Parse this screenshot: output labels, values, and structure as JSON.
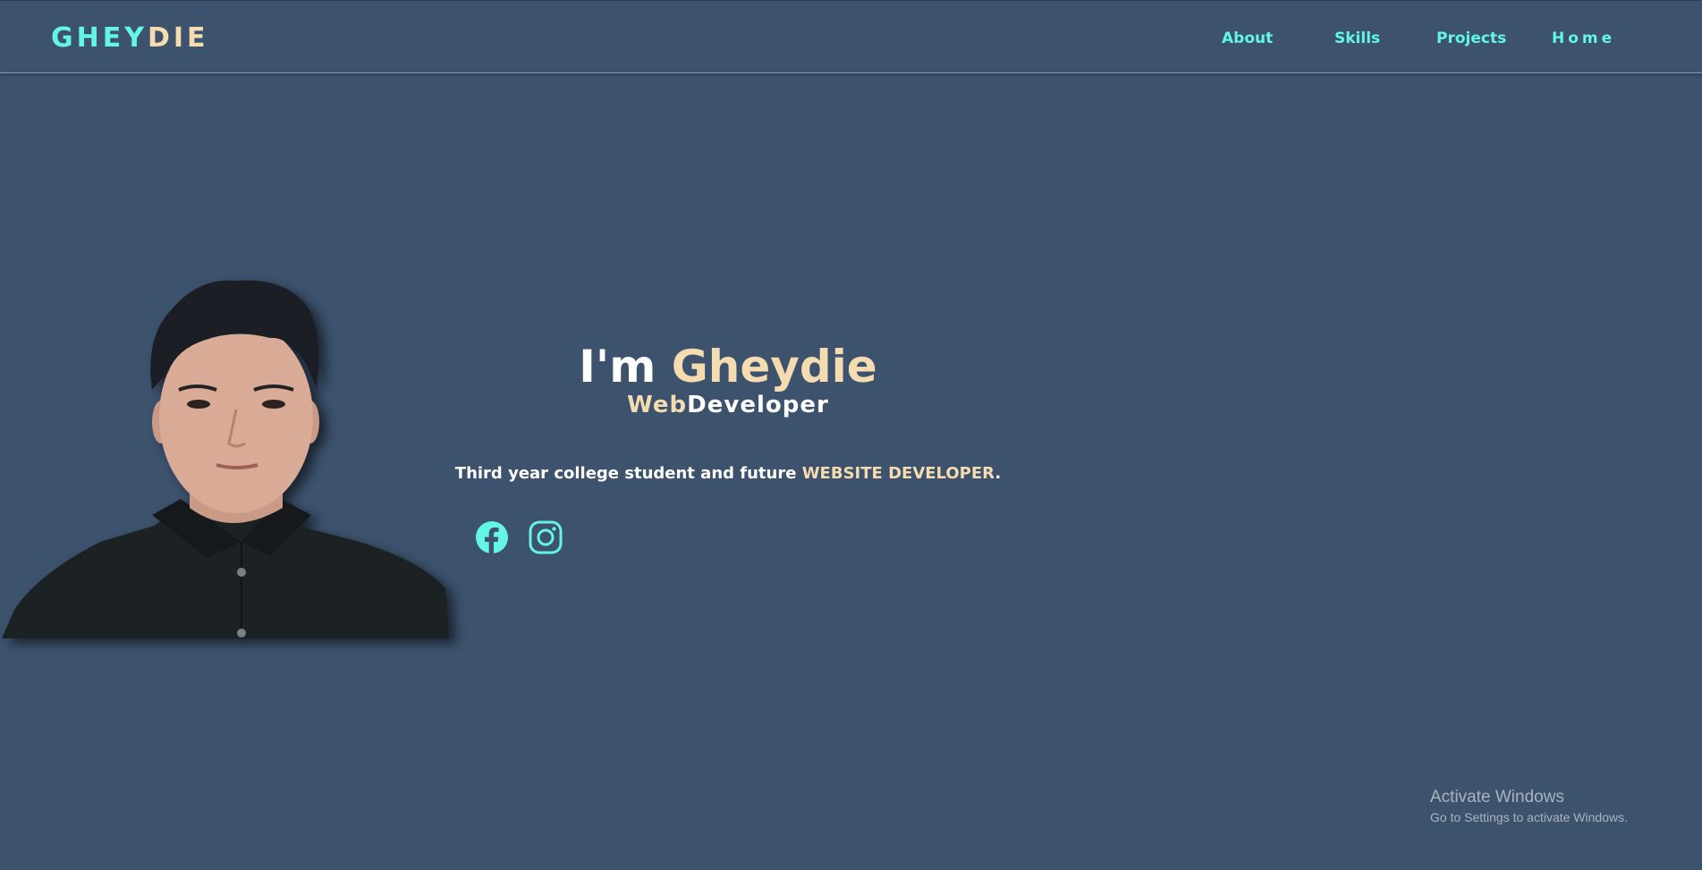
{
  "header": {
    "logo_part1": "GHEY",
    "logo_part2": "DIE",
    "nav": [
      {
        "label": "About"
      },
      {
        "label": "Skills"
      },
      {
        "label": "Projects"
      },
      {
        "label": "Home"
      }
    ]
  },
  "hero": {
    "greeting": "I'm ",
    "name": "Gheydie",
    "role_accent": "Web",
    "role": "Developer",
    "desc_prefix": "Third year college student and future ",
    "desc_accent": "WEBSITE DEVELOPER",
    "desc_suffix": "."
  },
  "social": [
    {
      "icon": "facebook-icon"
    },
    {
      "icon": "instagram-icon"
    }
  ],
  "watermark": {
    "line1": "Activate Windows",
    "line2": "Go to Settings to activate Windows."
  },
  "colors": {
    "background": "#3c526d",
    "accent_cyan": "#64f5e6",
    "accent_cream": "#f4dcb0",
    "text_white": "#ffffff"
  }
}
